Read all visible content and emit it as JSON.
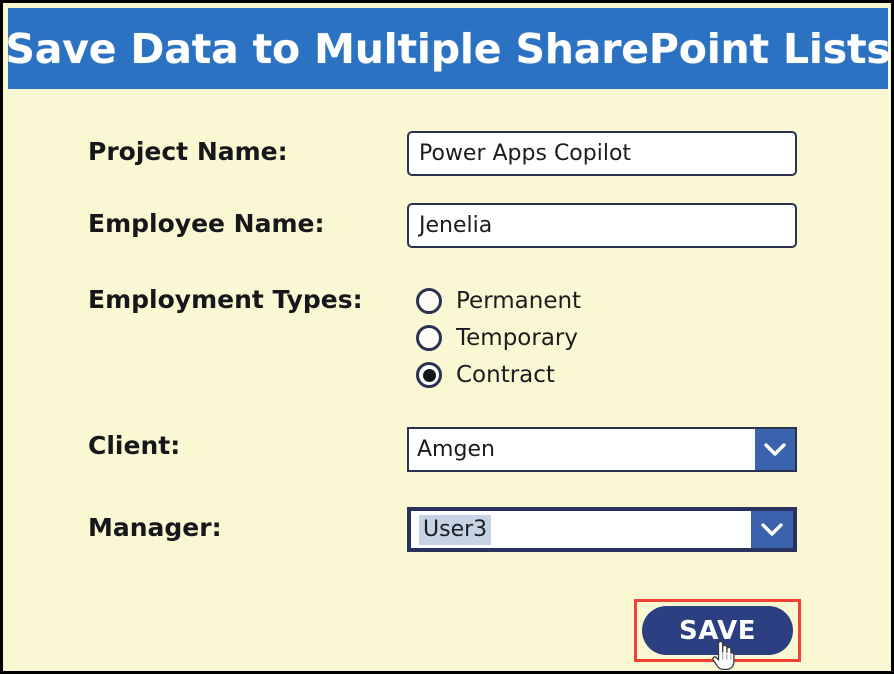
{
  "header": {
    "title": "Save Data to Multiple SharePoint Lists",
    "background_color": "#2b72c2",
    "text_color": "#ffffff"
  },
  "page": {
    "background_color": "#faf8d2"
  },
  "form": {
    "fields": [
      {
        "id": "project-name",
        "label": "Project Name:",
        "control": "text",
        "value": "Power Apps Copilot",
        "placeholder": ""
      },
      {
        "id": "employee-name",
        "label": "Employee Name:",
        "control": "text",
        "value": "Jenelia",
        "placeholder": ""
      },
      {
        "id": "employment-types",
        "label": "Employment Types:",
        "control": "radio-group"
      },
      {
        "id": "client",
        "label": "Client:",
        "control": "dropdown",
        "value": "Amgen"
      },
      {
        "id": "manager",
        "label": "Manager:",
        "control": "dropdown",
        "value": "User3"
      }
    ],
    "employment_types": {
      "options": [
        {
          "label": "Permanent",
          "selected": false
        },
        {
          "label": "Temporary",
          "selected": false
        },
        {
          "label": "Contract",
          "selected": true
        }
      ]
    },
    "client_dropdown": {
      "selected": "Amgen",
      "chevron_icon": "chevron-down-icon",
      "focused": false
    },
    "manager_dropdown": {
      "selected": "User3",
      "chevron_icon": "chevron-down-icon",
      "focused": true,
      "highlight_color": "#c6d3e5"
    }
  },
  "actions": {
    "save_label": "SAVE",
    "save_button_color": "#2c3f80",
    "annotation_color": "#ef4136"
  },
  "cursor": {
    "icon": "pointing-hand-cursor"
  }
}
